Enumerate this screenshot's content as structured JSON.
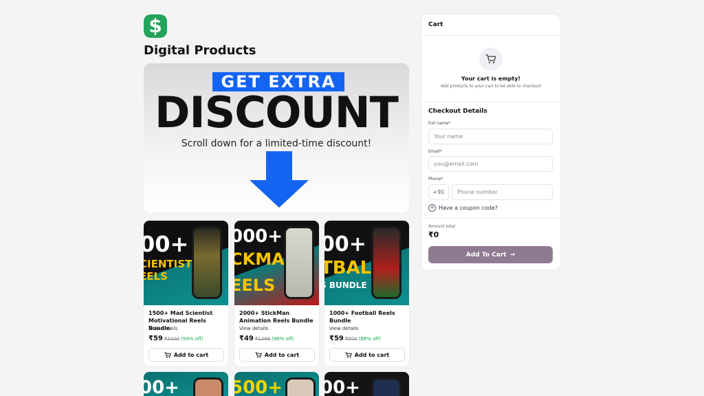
{
  "brand": {
    "logo_glyph": "$",
    "logo_color": "#22a45a"
  },
  "page_title": "Digital Products",
  "banner": {
    "pill_text": "GET EXTRA",
    "headline": "DISCOUNT",
    "subtext": "Scroll down for a limited-time discount!",
    "accent": "#1464f2"
  },
  "products": [
    {
      "thumb_text": "00+",
      "thumb_text2": "CIENTIST",
      "thumb_text3": "EELS",
      "title": "1500+ Mad Scientist Motivational Reels Bundle",
      "link": "View details",
      "price": "₹59",
      "old_price": "₹1000",
      "discount": "(94% off)",
      "button": "Add to cart"
    },
    {
      "thumb_text": "000+",
      "thumb_text2": "CKMAN",
      "thumb_text3": "EELS",
      "title": "2000+ StickMan Animation Reels Bundle",
      "link": "View details",
      "price": "₹49",
      "old_price": "₹1399",
      "discount": "(96% off)",
      "button": "Add to cart"
    },
    {
      "thumb_text": "00+",
      "thumb_text2": "TBALL",
      "thumb_text3": "S BUNDLE",
      "title": "1000+ Football Reels Bundle",
      "link": "View details",
      "price": "₹59",
      "old_price": "₹500",
      "discount": "(88% off)",
      "button": "Add to cart"
    }
  ],
  "more_products": [
    {
      "thumb_text": "00+"
    },
    {
      "thumb_text": "500+"
    },
    {
      "thumb_text": "00+"
    }
  ],
  "cart": {
    "title": "Cart",
    "empty_title": "Your cart is empty!",
    "empty_sub": "Add products to your cart to be able to checkout",
    "icon": "cart-icon"
  },
  "checkout": {
    "title": "Checkout Details",
    "name_label": "Full name*",
    "name_placeholder": "Your name",
    "email_label": "Email*",
    "email_placeholder": "you@email.com",
    "phone_label": "Phone*",
    "phone_code": "+91",
    "phone_placeholder": "Phone number",
    "coupon": "Have a coupon code?",
    "amount_label": "Amount total",
    "amount_value": "₹0",
    "button": "Add To Cart",
    "button_color": "#8f7b91"
  }
}
